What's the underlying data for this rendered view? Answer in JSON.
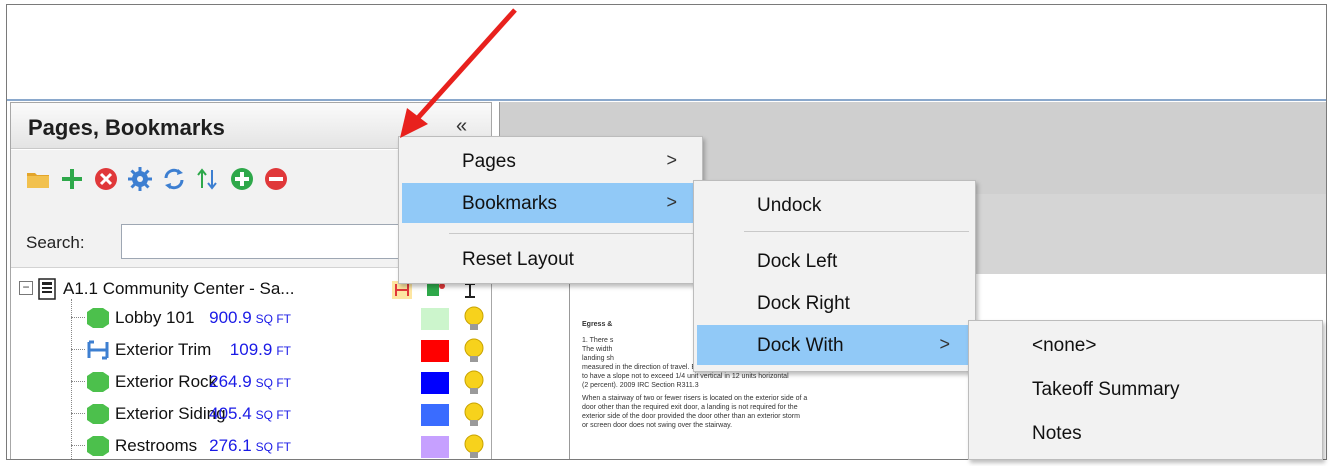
{
  "panel": {
    "title": "Pages, Bookmarks",
    "collapse_label": "«",
    "search_label": "Search:",
    "search_value": ""
  },
  "toolbar": {
    "icons": [
      "folder-icon",
      "add-icon",
      "delete-icon",
      "settings-icon",
      "refresh-icon",
      "sort-icon",
      "expand-all-icon",
      "collapse-all-icon"
    ]
  },
  "tree": {
    "root": {
      "label": "A1.1 Community Center - Sa...",
      "expander": "−"
    },
    "items": [
      {
        "label": "Lobby 101",
        "value": "900.9",
        "unit": "SQ FT",
        "color": "#ccf5cc",
        "icon": "area-icon"
      },
      {
        "label": "Exterior Trim",
        "value": "109.9",
        "unit": "FT",
        "color": "#ff0000",
        "icon": "linear-icon"
      },
      {
        "label": "Exterior Rock",
        "value": "264.9",
        "unit": "SQ FT",
        "color": "#0000ff",
        "icon": "area-icon"
      },
      {
        "label": "Exterior Siding",
        "value": "405.4",
        "unit": "SQ FT",
        "color": "#3a6cff",
        "icon": "area-icon"
      },
      {
        "label": "Restrooms",
        "value": "276.1",
        "unit": "SQ FT",
        "color": "#c6a0ff",
        "icon": "area-icon"
      }
    ]
  },
  "menu1": {
    "items": [
      {
        "label": "Pages",
        "arrow": ">"
      },
      {
        "label": "Bookmarks",
        "arrow": ">"
      },
      {
        "label": "Reset Layout",
        "arrow": ""
      }
    ]
  },
  "menu2": {
    "items": [
      {
        "label": "Undock",
        "arrow": ""
      },
      {
        "label": "Dock Left",
        "arrow": ""
      },
      {
        "label": "Dock Right",
        "arrow": ""
      },
      {
        "label": "Dock With",
        "arrow": ">"
      }
    ]
  },
  "menu3": {
    "items": [
      {
        "label": "<none>"
      },
      {
        "label": "Takeoff Summary"
      },
      {
        "label": "Notes"
      }
    ]
  },
  "document": {
    "heading": "Egress &",
    "para1": "1. There s\nThe width\nlanding sh\nmeasured in the direction of travel. Exterior landings shall be permitted\nto have a slope not to exceed 1/4 unit vertical in 12 units horizontal\n(2 percent). 2009 IRC Section R311.3",
    "para2": "When a stairway of two or fewer risers is located on the exterior side of a\ndoor other than the required exit door, a landing is not required for the\nexterior side of the door provided the door other than an exterior storm\nor screen door does not swing over the stairway."
  },
  "colors": {
    "menu_highlight": "#91c9f7",
    "annotation_arrow": "#e8211d",
    "value_text": "#1a1ae6"
  }
}
